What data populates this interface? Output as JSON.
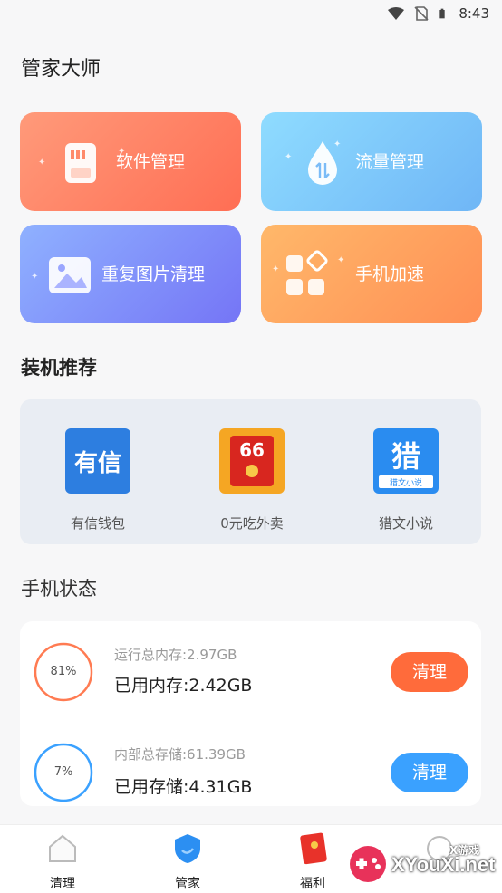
{
  "status_bar": {
    "time": "8:43",
    "icons": [
      "wifi-icon",
      "no-sim-icon",
      "battery-icon"
    ]
  },
  "page_title": "管家大师",
  "tools": [
    {
      "label": "软件管理",
      "icon": "sd-card-icon",
      "color": "#ff6e54"
    },
    {
      "label": "流量管理",
      "icon": "water-drop-icon",
      "color": "#6fb6f6"
    },
    {
      "label": "重复图片清理",
      "icon": "image-icon",
      "color": "#7575f6"
    },
    {
      "label": "手机加速",
      "icon": "grid-boost-icon",
      "color": "#ff8f55"
    }
  ],
  "recommend": {
    "title": "装机推荐",
    "apps": [
      {
        "label": "有信钱包",
        "icon_text": "有信",
        "icon": "youxin-app-icon"
      },
      {
        "label": "0元吃外卖",
        "icon_text": "66",
        "icon": "red-envelope-app-icon"
      },
      {
        "label": "猎文小说",
        "icon_text": "猎",
        "icon_sub": "猎文小说",
        "icon": "liewen-app-icon"
      }
    ]
  },
  "phone_status": {
    "title": "手机状态",
    "items": [
      {
        "percent": 81,
        "percent_label": "81%",
        "total": "运行总内存:2.97GB",
        "used": "已用内存:2.42GB",
        "button": "清理",
        "color": "#ff6b3b"
      },
      {
        "percent": 7,
        "percent_label": "7%",
        "total": "内部总存储:61.39GB",
        "used": "已用存储:4.31GB",
        "button": "清理",
        "color": "#3aa1ff"
      }
    ]
  },
  "tabs": [
    {
      "label": "清理",
      "icon": "house-icon"
    },
    {
      "label": "管家",
      "icon": "shield-icon",
      "active": true
    },
    {
      "label": "福利",
      "icon": "red-packet-icon"
    },
    {
      "label": "",
      "icon": "circle-icon"
    }
  ],
  "watermark": {
    "text": "XYouXi.net",
    "sub": "X游戏"
  }
}
